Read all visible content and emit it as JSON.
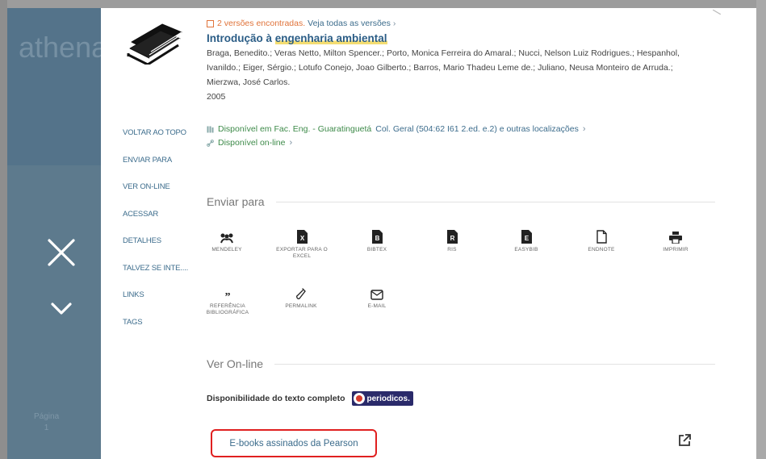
{
  "background": {
    "logo_text": "athena",
    "page_label": "Página",
    "page_number": "1"
  },
  "sidenav": {
    "items": [
      {
        "label": "VOLTAR AO TOPO"
      },
      {
        "label": "ENVIAR PARA"
      },
      {
        "label": "VER ON-LINE"
      },
      {
        "label": "ACESSAR"
      },
      {
        "label": "DETALHES"
      },
      {
        "label": "TALVEZ SE INTE...."
      },
      {
        "label": "LINKS"
      },
      {
        "label": "TAGS"
      }
    ]
  },
  "record": {
    "versions_found": "2 versões encontradas.",
    "versions_link": "Veja todas as versões",
    "title_prefix": "Introdução à ",
    "title_highlight": "engenharia ambiental",
    "authors": "Braga, Benedito.; Veras Netto, Milton Spencer.; Porto, Monica Ferreira do Amaral.; Nucci, Nelson Luiz Rodrigues.; Hespanhol, Ivanildo.; Eiger, Sérgio.; Lotufo Conejo, Joao Gilberto.; Barros, Mario Thadeu Leme de.; Juliano, Neusa Monteiro de Arruda.; Mierzwa, José Carlos.",
    "year": "2005",
    "availability_location": "Disponível em Fac. Eng. - Guaratinguetá",
    "availability_detail": "Col. Geral (504:62 I61 2.ed. e.2) e outras localizações",
    "online": "Disponível on-line"
  },
  "send_to": {
    "heading": "Enviar para",
    "actions": [
      {
        "label": "MENDELEY",
        "icon": "mendeley-icon"
      },
      {
        "label": "EXPORTAR PARA O EXCEL",
        "icon": "excel-export-icon"
      },
      {
        "label": "BIBTEX",
        "icon": "bibtex-icon"
      },
      {
        "label": "RIS",
        "icon": "ris-icon"
      },
      {
        "label": "EASYBIB",
        "icon": "easybib-icon"
      },
      {
        "label": "ENDNOTE",
        "icon": "endnote-icon"
      },
      {
        "label": "IMPRIMIR",
        "icon": "print-icon"
      },
      {
        "label": "REFERÊNCIA BIBLIOGRÁFICA",
        "icon": "quote-icon"
      },
      {
        "label": "PERMALINK",
        "icon": "link-icon"
      },
      {
        "label": "E-MAIL",
        "icon": "email-icon"
      }
    ]
  },
  "online": {
    "heading": "Ver On-line",
    "fulltext_label": "Disponibilidade do texto completo",
    "provider_badge": "periodicos.",
    "ebook_link": "E-books assinados da Pearson"
  },
  "colors": {
    "accent_blue": "#3c6c8c",
    "available_green": "#3d8a49",
    "highlight_box": "#e02020",
    "side_strip": "#5d7a8d"
  }
}
